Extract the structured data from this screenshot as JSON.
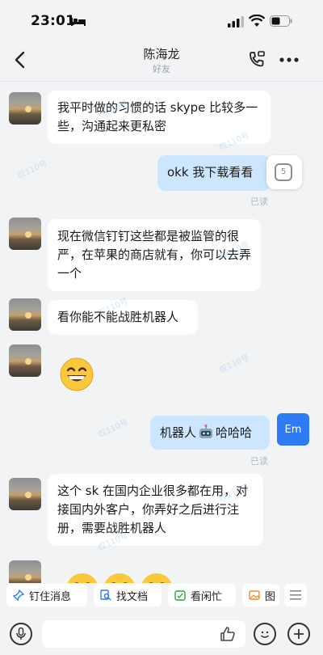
{
  "status_bar": {
    "time": "23:01"
  },
  "header": {
    "title": "陈海龙",
    "subtitle": "好友"
  },
  "messages": [
    {
      "side": "left",
      "text": "我平时做的习惯的话 skype 比较多一些，沟通起来更私密"
    },
    {
      "side": "right",
      "text": "okk 我下载看看",
      "status": "已读"
    },
    {
      "side": "left",
      "text": "现在微信钉钉这些都是被监管的很严，在苹果的商店就有，你可以去弄一个"
    },
    {
      "side": "left",
      "text": "看你能不能战胜机器人"
    },
    {
      "side": "left",
      "emoji": "grinning-face"
    },
    {
      "side": "right",
      "text_before": "机器人",
      "text_after": "哈哈哈",
      "status": "已读"
    },
    {
      "side": "left",
      "text": "这个 sk 在国内企业很多都在用，对接国内外客户，你弄好之后进行注册，需要战胜机器人"
    }
  ],
  "me_avatar": "Em",
  "float_button": "5",
  "quick_actions": [
    {
      "label": "钉住消息",
      "icon": "pin-icon"
    },
    {
      "label": "找文档",
      "icon": "search-doc-icon"
    },
    {
      "label": "看闲忙",
      "icon": "calendar-check-icon"
    },
    {
      "label": "图",
      "icon": "image-icon"
    }
  ],
  "colors": {
    "my_bubble": "#cde6ff",
    "accent": "#2d7cf6",
    "background": "#f2f3f5"
  },
  "watermark": "叹110号"
}
